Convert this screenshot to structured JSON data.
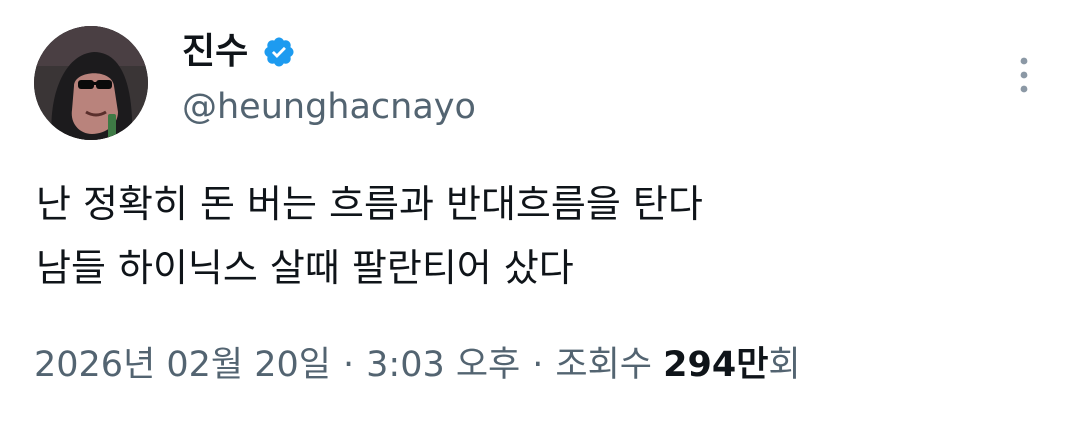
{
  "author": {
    "display_name": "진수",
    "handle": "@heunghacnayo",
    "verified": true,
    "avatar_icon": "avatar-sunglasses-character"
  },
  "post": {
    "lines": [
      "난 정확히 돈 버는 흐름과 반대흐름을 탄다",
      "남들 하이닉스 살때 팔란티어 샀다"
    ]
  },
  "meta": {
    "date": "2026년 02월 20일",
    "separator": "·",
    "time": "3:03 오후",
    "views_label": "조회수",
    "views_count": "294만",
    "views_suffix": "회"
  },
  "colors": {
    "verified_badge": "#1d9bf0",
    "secondary_text": "#536471",
    "primary_text": "#0f1419",
    "background": "#ffffff"
  },
  "icons": {
    "more": "more-vertical-icon",
    "verified": "verified-badge-icon"
  }
}
